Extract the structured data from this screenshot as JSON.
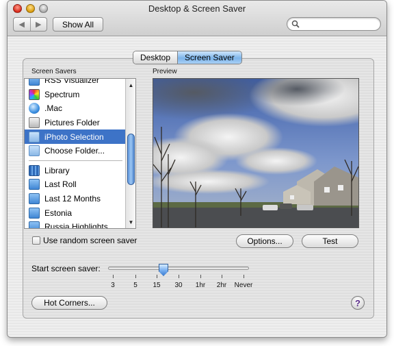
{
  "window": {
    "title": "Desktop & Screen Saver"
  },
  "toolbar": {
    "back_icon": "back-arrow-icon",
    "forward_icon": "forward-arrow-icon",
    "show_all_label": "Show All",
    "search_placeholder": ""
  },
  "tabs": [
    {
      "label": "Desktop",
      "selected": false
    },
    {
      "label": "Screen Saver",
      "selected": true
    }
  ],
  "screen_savers": {
    "heading": "Screen Savers",
    "items": [
      {
        "label": "RSS Visualizer",
        "icon": "rss-icon"
      },
      {
        "label": "Spectrum",
        "icon": "spectrum-icon"
      },
      {
        "label": ".Mac",
        "icon": "dotmac-globe-icon"
      },
      {
        "label": "Pictures Folder",
        "icon": "pictures-folder-icon"
      },
      {
        "label": "iPhoto Selection",
        "icon": "folder-icon",
        "selected": true
      },
      {
        "label": "Choose Folder...",
        "icon": "folder-icon"
      },
      {
        "label": "Library",
        "icon": "iphoto-library-icon"
      },
      {
        "label": "Last Roll",
        "icon": "folder-icon"
      },
      {
        "label": "Last 12 Months",
        "icon": "folder-icon"
      },
      {
        "label": "Estonia",
        "icon": "folder-icon"
      },
      {
        "label": "Russia Highlights",
        "icon": "folder-icon"
      }
    ]
  },
  "preview": {
    "heading": "Preview"
  },
  "options": {
    "random_label": "Use random screen saver",
    "random_checked": false,
    "options_button": "Options...",
    "test_button": "Test"
  },
  "start_screen_saver": {
    "label": "Start screen saver:",
    "ticks": [
      "3",
      "5",
      "15",
      "30",
      "1hr",
      "2hr",
      "Never"
    ],
    "selected": "15"
  },
  "footer": {
    "hot_corners_button": "Hot Corners...",
    "help_label": "?"
  },
  "colors": {
    "selection": "#3d73c7",
    "tab_active": "#7cb4ea"
  }
}
